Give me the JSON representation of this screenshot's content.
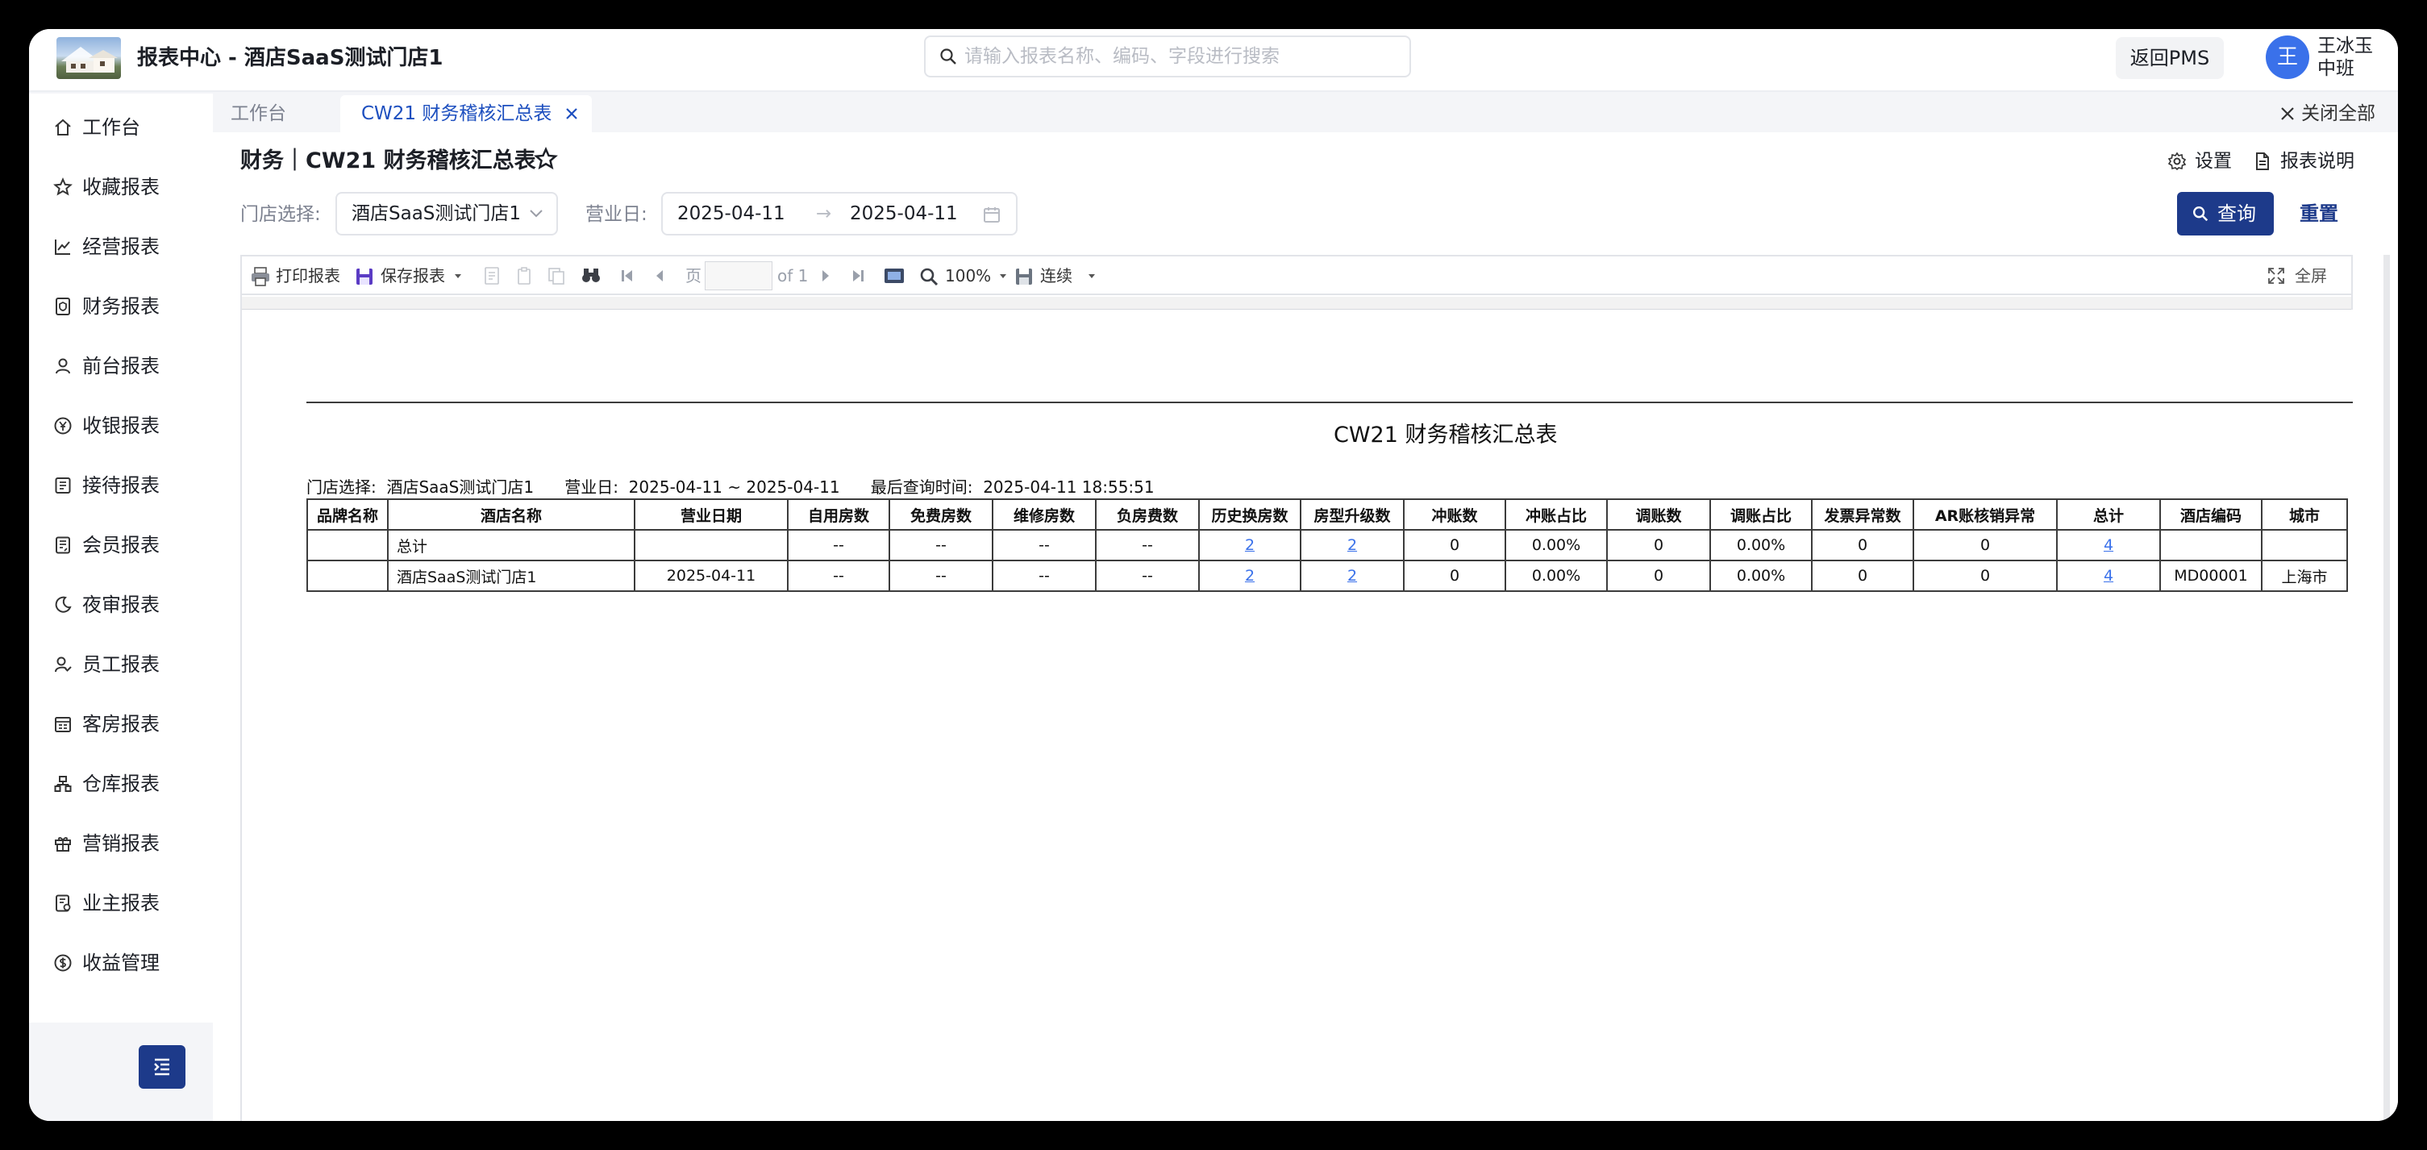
{
  "app": {
    "title": "报表中心 - 酒店SaaS测试门店1"
  },
  "search": {
    "placeholder": "请输入报表名称、编码、字段进行搜索"
  },
  "header": {
    "back_label": "返回PMS",
    "avatar_letter": "王",
    "user_name": "王冰玉",
    "user_shift": "中班"
  },
  "sidebar": {
    "items": [
      {
        "label": "工作台",
        "icon": "home-icon"
      },
      {
        "label": "收藏报表",
        "icon": "star-icon"
      },
      {
        "label": "经营报表",
        "icon": "line-chart-icon"
      },
      {
        "label": "财务报表",
        "icon": "shield-doc-icon"
      },
      {
        "label": "前台报表",
        "icon": "user-icon"
      },
      {
        "label": "收银报表",
        "icon": "yen-icon"
      },
      {
        "label": "接待报表",
        "icon": "list-doc-icon"
      },
      {
        "label": "会员报表",
        "icon": "member-doc-icon"
      },
      {
        "label": "夜审报表",
        "icon": "moon-icon"
      },
      {
        "label": "员工报表",
        "icon": "staff-icon"
      },
      {
        "label": "客房报表",
        "icon": "room-icon"
      },
      {
        "label": "仓库报表",
        "icon": "warehouse-icon"
      },
      {
        "label": "营销报表",
        "icon": "gift-icon"
      },
      {
        "label": "业主报表",
        "icon": "owner-doc-icon"
      },
      {
        "label": "收益管理",
        "icon": "dollar-icon"
      }
    ]
  },
  "tabs": {
    "workbench": "工作台",
    "active": "CW21 财务稽核汇总表",
    "close_all": "关闭全部"
  },
  "page": {
    "title": "财务｜CW21 财务稽核汇总表",
    "settings": "设置",
    "explain": "报表说明"
  },
  "filters": {
    "store_label": "门店选择:",
    "store_value": "酒店SaaS测试门店1",
    "date_label": "营业日:",
    "date_from": "2025-04-11",
    "date_sep": "→",
    "date_to": "2025-04-11",
    "query": "查询",
    "reset": "重置"
  },
  "viewer": {
    "print": "打印报表",
    "save": "保存报表",
    "page_label": "页",
    "page_of": "of 1",
    "zoom": "100%",
    "mode": "连续",
    "fullscreen": "全屏"
  },
  "report": {
    "title": "CW21 财务稽核汇总表",
    "meta": "门店选择:  酒店SaaS测试门店1      营业日:  2025-04-11 ~ 2025-04-11      最后查询时间:  2025-04-11 18:55:51",
    "columns": [
      "品牌名称",
      "酒店名称",
      "营业日期",
      "自用房数",
      "免费房数",
      "维修房数",
      "负房费数",
      "历史换房数",
      "房型升级数",
      "冲账数",
      "冲账占比",
      "调账数",
      "调账占比",
      "发票异常数",
      "AR账核销异常",
      "总计",
      "酒店编码",
      "城市"
    ],
    "rows": [
      [
        "",
        "总计",
        "",
        "--",
        "--",
        "--",
        "--",
        "2",
        "2",
        "0",
        "0.00%",
        "0",
        "0.00%",
        "0",
        "0",
        "4",
        "",
        ""
      ],
      [
        "",
        "酒店SaaS测试门店1",
        "2025-04-11",
        "--",
        "--",
        "--",
        "--",
        "2",
        "2",
        "0",
        "0.00%",
        "0",
        "0.00%",
        "0",
        "0",
        "4",
        "MD00001",
        "上海市"
      ]
    ]
  },
  "colors": {
    "primary": "#1d3a8a",
    "accent": "#3a71ea",
    "link": "#3a71ea"
  }
}
